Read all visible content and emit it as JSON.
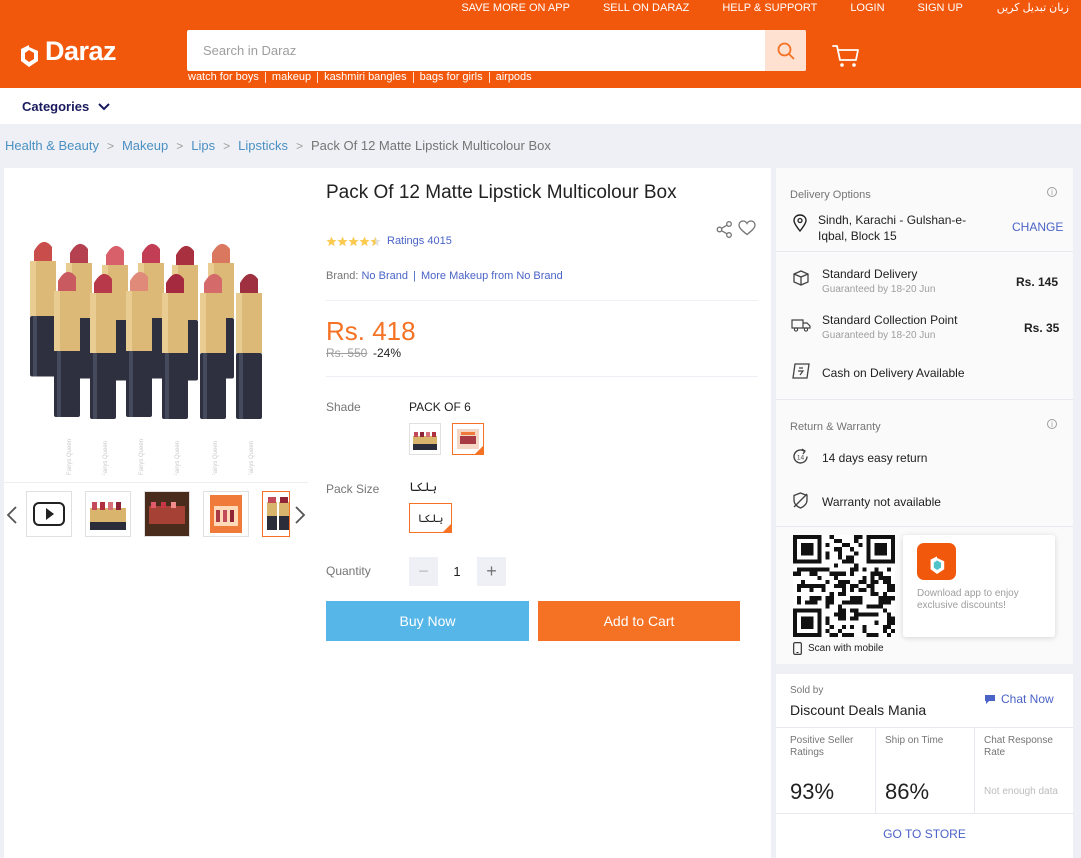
{
  "header": {
    "top_links": [
      "SAVE MORE ON APP",
      "SELL ON DARAZ",
      "HELP & SUPPORT",
      "LOGIN",
      "SIGN UP",
      "زبان تبدیل کریں"
    ],
    "logo_text": "Daraz",
    "search_placeholder": "Search in Daraz",
    "suggestions": [
      "watch for boys",
      "makeup",
      "kashmiri bangles",
      "bags for girls",
      "airpods"
    ],
    "categories_label": "Categories"
  },
  "breadcrumb": {
    "items": [
      "Health & Beauty",
      "Makeup",
      "Lips",
      "Lipsticks"
    ],
    "current": "Pack Of 12 Matte Lipstick Multicolour Box"
  },
  "product": {
    "title": "Pack Of 12 Matte Lipstick Multicolour Box",
    "ratings": "Ratings 4015",
    "rating_value": 4.5,
    "brand_label": "Brand:",
    "brand": "No Brand",
    "more_brand": "More Makeup from No Brand",
    "price": "Rs. 418",
    "old_price": "Rs. 550",
    "discount": "-24%",
    "shade_label": "Shade",
    "shade_value": "PACK OF 6",
    "pack_label": "Pack Size",
    "pack_value": "ہلکا",
    "pack_option": "ہلکا",
    "quantity_label": "Quantity",
    "quantity": "1",
    "buy_now": "Buy Now",
    "add_to_cart": "Add to Cart",
    "product_brand_print": "Fairys Queen"
  },
  "delivery": {
    "title": "Delivery Options",
    "location": "Sindh, Karachi - Gulshan-e-Iqbal, Block 15",
    "change": "CHANGE",
    "standard": "Standard Delivery",
    "standard_guarantee": "Guaranteed by 18-20 Jun",
    "standard_price": "Rs. 145",
    "collection": "Standard Collection Point",
    "collection_guarantee": "Guaranteed by 18-20 Jun",
    "collection_price": "Rs. 35",
    "cod": "Cash on Delivery Available"
  },
  "warranty": {
    "title": "Return & Warranty",
    "return": "14 days easy return",
    "return_icon_text": "14",
    "warranty": "Warranty not available"
  },
  "app": {
    "promo": "Download app to enjoy exclusive discounts!",
    "scan": "Scan with mobile"
  },
  "seller": {
    "sold_by": "Sold by",
    "name": "Discount Deals Mania",
    "chat": "Chat Now",
    "metric1_label": "Positive Seller Ratings",
    "metric1_value": "93%",
    "metric2_label": "Ship on Time",
    "metric2_value": "86%",
    "metric3_label": "Chat Response Rate",
    "metric3_value": "Not enough data",
    "go_to_store": "GO TO STORE"
  },
  "colors": {
    "brand_orange": "#f57224",
    "header_orange": "#f2580c",
    "buy_blue": "#57b6e8",
    "link_blue": "#4a63c6"
  }
}
